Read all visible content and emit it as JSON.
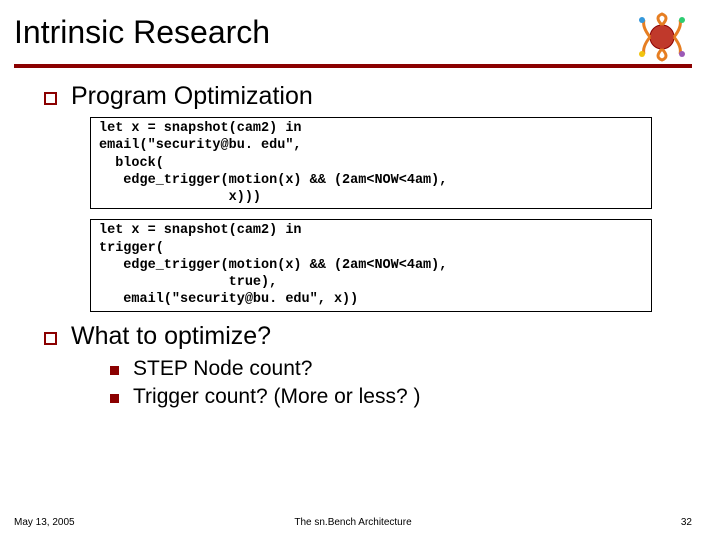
{
  "title": "Intrinsic Research",
  "logo_name": "institution-logo",
  "bullets": {
    "b1": "Program Optimization",
    "b2": "What to optimize?"
  },
  "code1": "let x = snapshot(cam2) in\nemail(\"security@bu. edu\",\n  block(\n   edge_trigger(motion(x) && (2am<NOW<4am),\n                x)))",
  "code2": "let x = snapshot(cam2) in\ntrigger(\n   edge_trigger(motion(x) && (2am<NOW<4am),\n                true),\n   email(\"security@bu. edu\", x))",
  "sub": {
    "s1": "STEP Node count?",
    "s2": "Trigger count?  (More or less? )"
  },
  "footer": {
    "date": "May 13, 2005",
    "center": "The sn.Bench Architecture",
    "page": "32"
  }
}
